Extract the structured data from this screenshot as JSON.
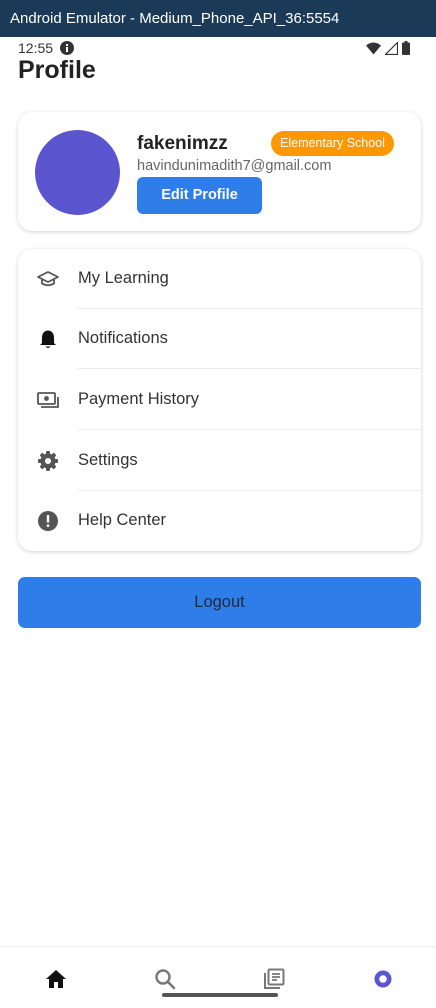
{
  "window": {
    "title": "Android Emulator - Medium_Phone_API_36:5554"
  },
  "status_bar": {
    "time": "12:55"
  },
  "page": {
    "title": "Profile"
  },
  "profile": {
    "username": "fakenimzz",
    "level_badge": "Elementary School",
    "email": "havindunimadith7@gmail.com",
    "edit_button_label": "Edit Profile"
  },
  "menu": {
    "items": [
      {
        "label": "My Learning",
        "icon": "graduation-cap-icon"
      },
      {
        "label": "Notifications",
        "icon": "bell-icon"
      },
      {
        "label": "Payment History",
        "icon": "payments-icon"
      },
      {
        "label": "Settings",
        "icon": "gear-icon"
      },
      {
        "label": "Help Center",
        "icon": "alert-circle-icon"
      }
    ]
  },
  "logout": {
    "label": "Logout"
  },
  "bottom_nav": {
    "items": [
      {
        "icon": "home-icon",
        "active": true
      },
      {
        "icon": "search-icon",
        "active": false
      },
      {
        "icon": "library-icon",
        "active": false
      },
      {
        "icon": "profile-ring-icon",
        "active": true
      }
    ]
  },
  "colors": {
    "titlebar": "#1b3a57",
    "accent_blue": "#2f7de9",
    "badge_orange": "#ff9800",
    "avatar_purple": "#5b55cf"
  }
}
